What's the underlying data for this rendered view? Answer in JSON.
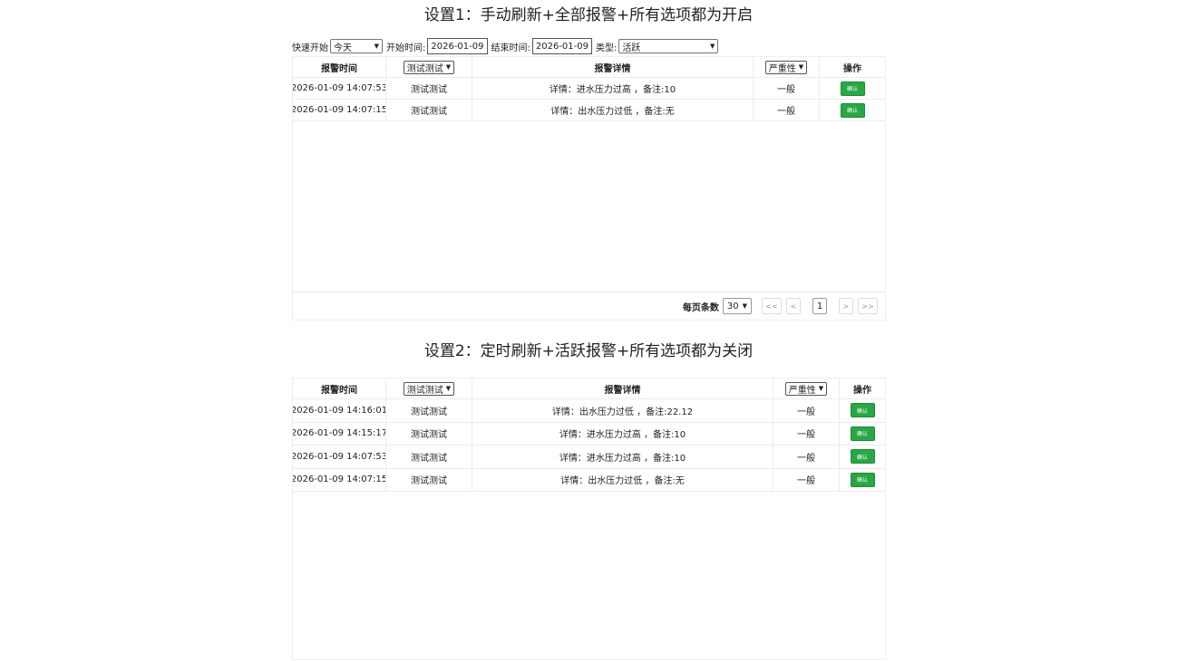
{
  "headings": {
    "setting1": "设置1：手动刷新+全部报警+所有选项都为开启",
    "setting2": "设置2：定时刷新+活跃报警+所有选项都为关闭"
  },
  "filters": {
    "quick_start_label": "快速开始",
    "quick_start_value": "今天",
    "start_time_label": "开始时间:",
    "start_time_value": "2026-01-09",
    "end_time_label": "结束时间:",
    "end_time_value": "2026-01-09",
    "type_label": "类型:",
    "type_value": "活跃"
  },
  "table1": {
    "headers": {
      "time": "报警时间",
      "source_filter": "测试测试",
      "detail": "报警详情",
      "severity_filter": "严重性",
      "action": "操作"
    },
    "rows": [
      {
        "time": "2026-01-09 14:07:53",
        "source": "测试测试",
        "detail": "详情：进水压力过高 ，备注:10",
        "severity": "一般",
        "action": "确认"
      },
      {
        "time": "2026-01-09 14:07:15",
        "source": "测试测试",
        "detail": "详情：出水压力过低 ，备注:无",
        "severity": "一般",
        "action": "确认"
      }
    ],
    "pager": {
      "page_size_label": "每页条数",
      "page_size_value": "30",
      "first": "<<",
      "prev": "<",
      "current": "1",
      "next": ">",
      "last": ">>"
    }
  },
  "table2": {
    "headers": {
      "time": "报警时间",
      "source_filter": "测试测试",
      "detail": "报警详情",
      "severity_filter": "严重性",
      "action": "操作"
    },
    "rows": [
      {
        "time": "2026-01-09 14:16:01",
        "source": "测试测试",
        "detail": "详情：出水压力过低 ，备注:22.12",
        "severity": "一般",
        "action": "确认"
      },
      {
        "time": "2026-01-09 14:15:17",
        "source": "测试测试",
        "detail": "详情：进水压力过高 ，备注:10",
        "severity": "一般",
        "action": "确认"
      },
      {
        "time": "2026-01-09 14:07:53",
        "source": "测试测试",
        "detail": "详情：进水压力过高 ，备注:10",
        "severity": "一般",
        "action": "确认"
      },
      {
        "time": "2026-01-09 14:07:15",
        "source": "测试测试",
        "detail": "详情：出水压力过低 ，备注:无",
        "severity": "一般",
        "action": "确认"
      }
    ]
  },
  "icons": {
    "dropdown": "chevron-down-icon"
  },
  "colors": {
    "confirm_button": "#28a745"
  }
}
